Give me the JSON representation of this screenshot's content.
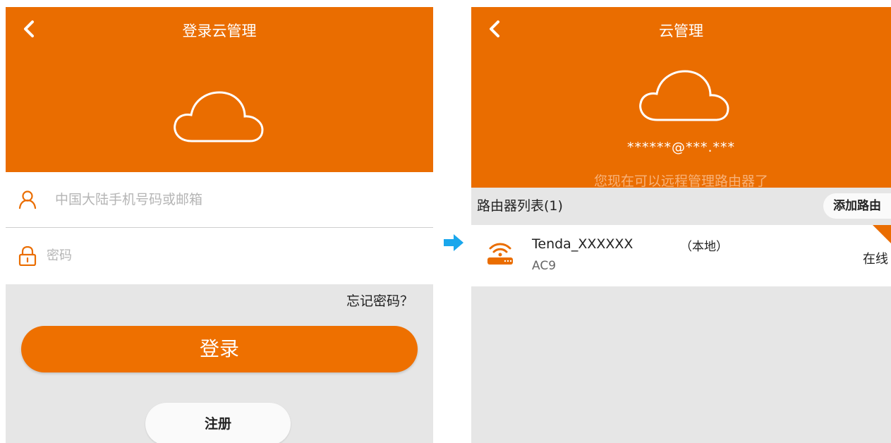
{
  "login": {
    "title": "登录云管理",
    "username_placeholder": "中国大陆手机号码或邮箱",
    "password_placeholder": "密码",
    "forgot_label": "忘记密码？",
    "login_label": "登录",
    "register_label": "注册"
  },
  "cloud": {
    "title": "云管理",
    "account": "******@***.***",
    "tip": "您现在可以远程管理路由器了",
    "list_title": "路由器列表(1)",
    "add_label": "添加路由",
    "router": {
      "name": "Tenda_XXXXXX",
      "local": "（本地）",
      "model": "AC9",
      "status": "在线"
    }
  },
  "icons": {
    "back": "chevron-left-icon",
    "cloud": "cloud-icon",
    "user": "user-icon",
    "lock": "lock-icon",
    "router": "wifi-router-icon",
    "arrow": "arrow-right-icon"
  },
  "colors": {
    "brand": "#ea6d00",
    "login_button": "#ee7000",
    "tip_text": "#f7b27a",
    "arrow": "#1aa7ec",
    "background": "#e6e6e6"
  }
}
